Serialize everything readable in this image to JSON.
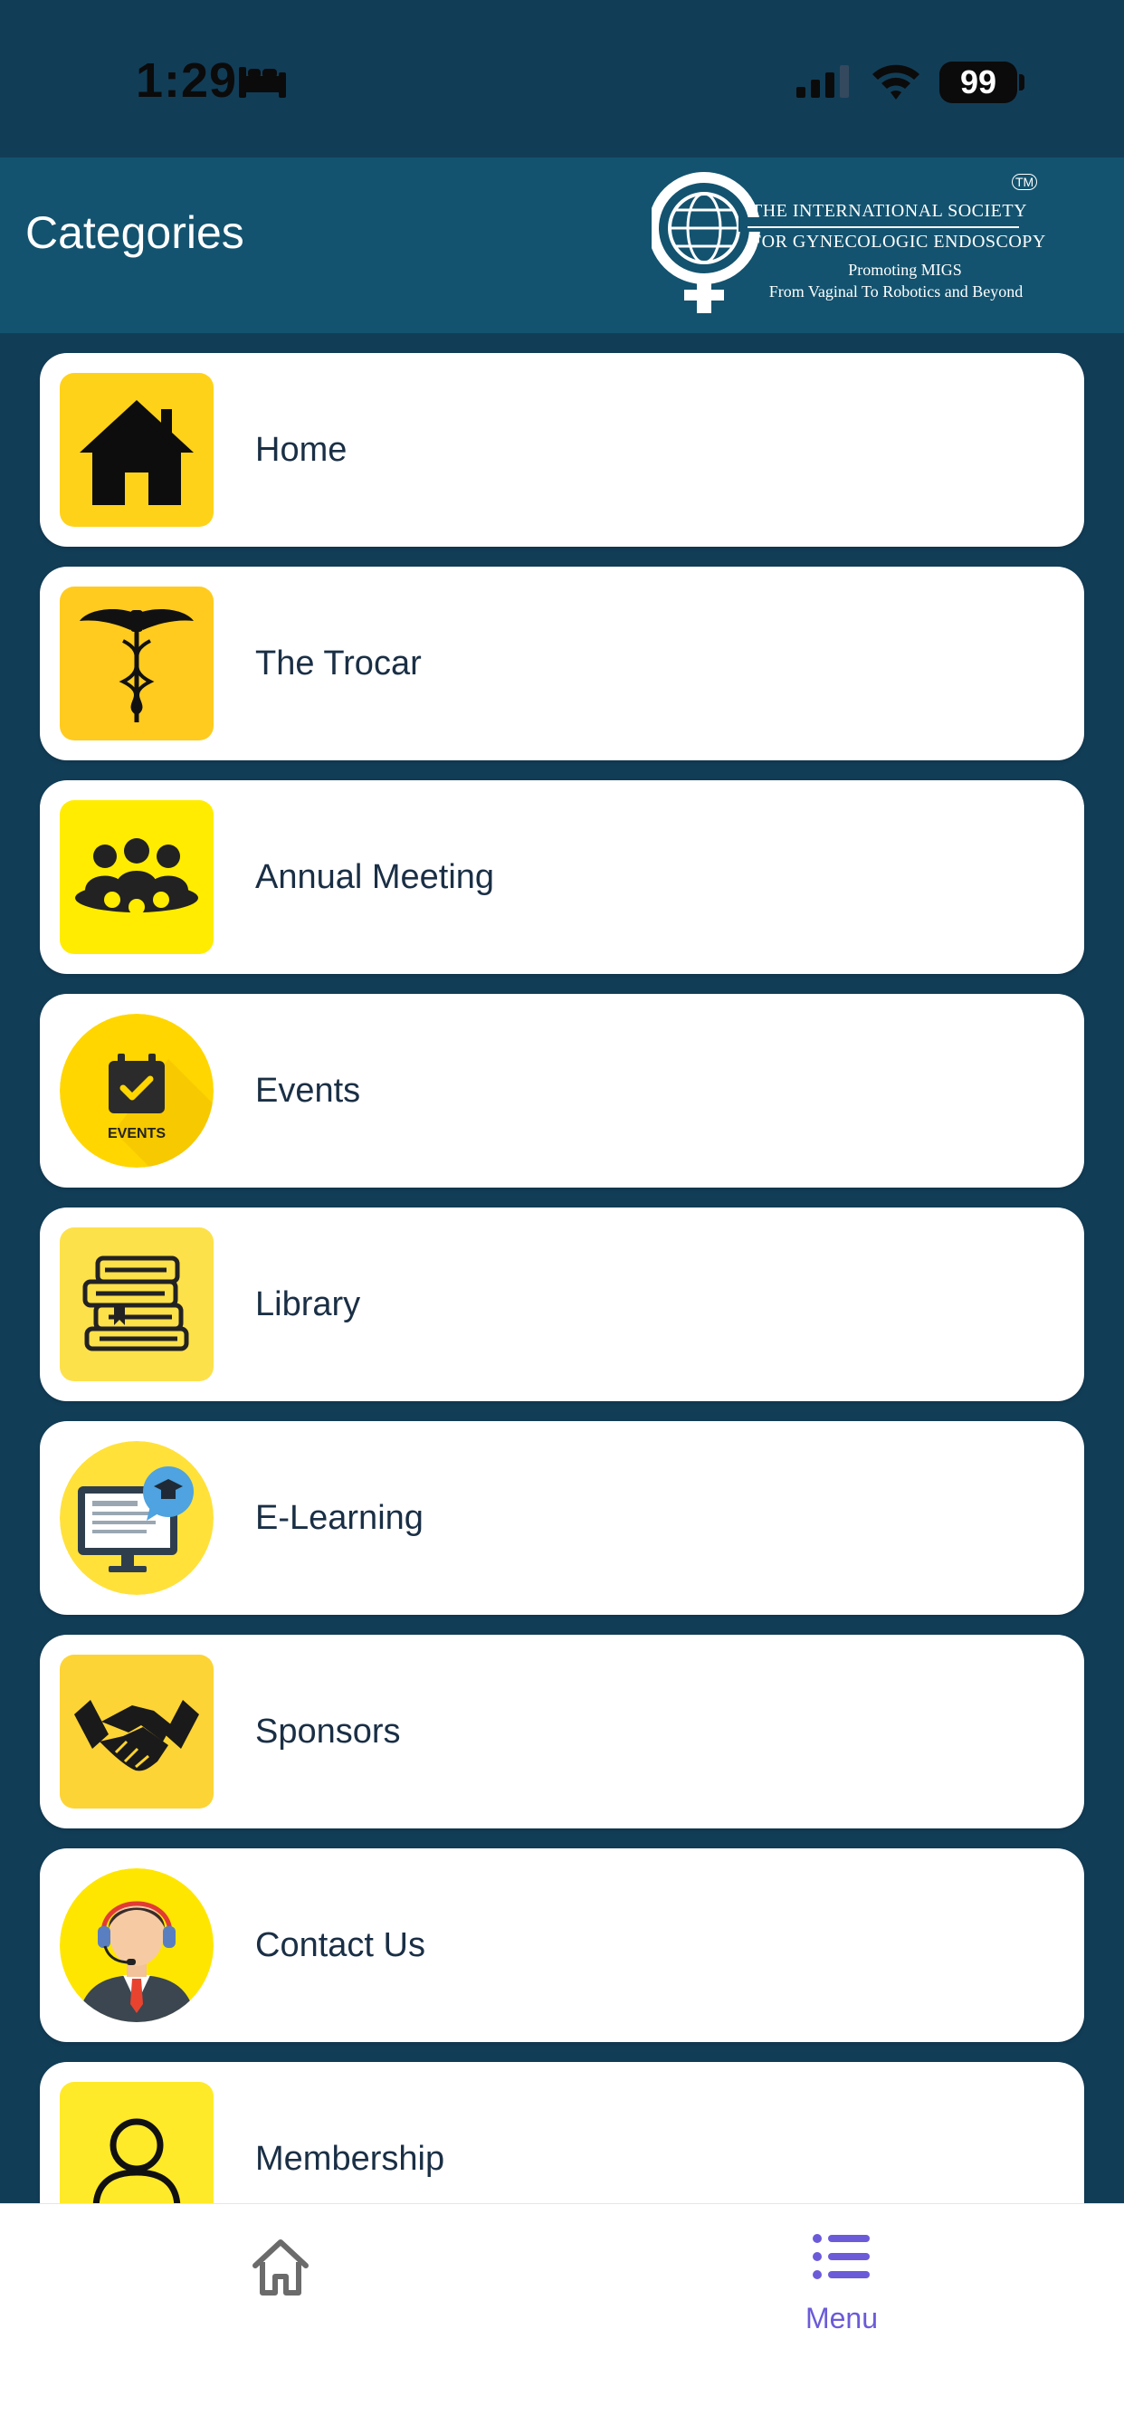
{
  "status": {
    "time": "1:29",
    "battery": "99"
  },
  "header": {
    "title": "Categories",
    "logo": {
      "line1": "THE INTERNATIONAL SOCIETY",
      "line2": "FOR GYNECOLOGIC ENDOSCOPY",
      "line3": "Promoting MIGS",
      "line4": "From Vaginal To Robotics and Beyond",
      "tm": "TM"
    }
  },
  "categories": [
    {
      "label": "Home",
      "icon": "house-icon"
    },
    {
      "label": "The Trocar",
      "icon": "caduceus-icon"
    },
    {
      "label": "Annual Meeting",
      "icon": "group-meeting-icon"
    },
    {
      "label": "Events",
      "icon": "events-calendar-icon",
      "icon_text": "EVENTS"
    },
    {
      "label": "Library",
      "icon": "books-icon"
    },
    {
      "label": "E-Learning",
      "icon": "elearning-monitor-icon"
    },
    {
      "label": "Sponsors",
      "icon": "handshake-icon"
    },
    {
      "label": "Contact Us",
      "icon": "support-agent-icon"
    },
    {
      "label": "Membership",
      "icon": "user-icon"
    }
  ],
  "tabbar": {
    "home_icon": "home-outline-icon",
    "menu_label": "Menu",
    "menu_icon": "list-icon",
    "active_color": "#6b5bd8"
  },
  "colors": {
    "background": "#123d57",
    "header": "#13536f",
    "icon_yellow": "#ffd21a"
  }
}
